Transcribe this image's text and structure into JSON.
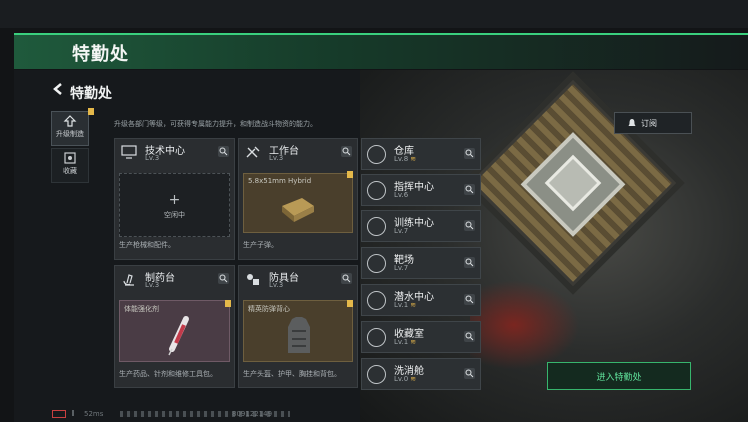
{
  "banner": {
    "title": "特勤处"
  },
  "header": {
    "title": "特勤处",
    "subtitle": "升级各部门等级，可获得专属能力提升，和制造战斗物资的能力。"
  },
  "side_tabs": [
    {
      "label": "升级制造",
      "active": true
    },
    {
      "label": "收藏",
      "active": false
    }
  ],
  "cards": [
    {
      "name": "技术中心",
      "level": "Lv.3",
      "slot_type": "empty",
      "slot_text": "空闲中",
      "slot_plus": "+",
      "description": "生产枪械和配件。"
    },
    {
      "name": "工作台",
      "level": "Lv.3",
      "slot_type": "item",
      "slot_text": "5.8x51mm Hybrid",
      "description": "生产子弹。"
    },
    {
      "name": "制药台",
      "level": "Lv.3",
      "slot_type": "item",
      "slot_text": "体能强化剂",
      "description": "生产药品、针剂和维修工具包。"
    },
    {
      "name": "防具台",
      "level": "Lv.3",
      "slot_type": "item",
      "slot_text": "精英防弹背心",
      "description": "生产头盔、护甲、胸挂和背包。"
    }
  ],
  "right_cards": [
    {
      "name": "仓库",
      "level": "Lv.8",
      "upgrade": true
    },
    {
      "name": "指挥中心",
      "level": "Lv.6",
      "upgrade": false
    },
    {
      "name": "训练中心",
      "level": "Lv.7",
      "upgrade": false
    },
    {
      "name": "靶场",
      "level": "Lv.7",
      "upgrade": false
    },
    {
      "name": "潜水中心",
      "level": "Lv.1",
      "upgrade": true
    },
    {
      "name": "收藏室",
      "level": "Lv.1",
      "upgrade": true
    },
    {
      "name": "洗消舱",
      "level": "Lv.0",
      "upgrade": true
    }
  ],
  "buttons": {
    "subscribe": "订阅",
    "enter": "进入特勤处"
  },
  "status": {
    "ping": "52ms",
    "uid": "809122149"
  },
  "colors": {
    "accent": "#3ad07e",
    "upgrade": "#e2b34a"
  }
}
